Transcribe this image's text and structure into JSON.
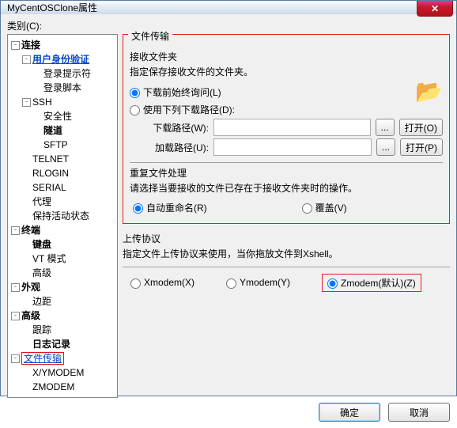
{
  "window": {
    "title": "MyCentOSClone属性",
    "close_aria": "Close"
  },
  "category_label": "类别(C):",
  "tree": {
    "conn": "连接",
    "auth": "用户身份验证",
    "loginprompt": "登录提示符",
    "loginscript": "登录脚本",
    "ssh": "SSH",
    "security": "安全性",
    "tunnel": "隧道",
    "sftp": "SFTP",
    "telnet": "TELNET",
    "rlogin": "RLOGIN",
    "serial": "SERIAL",
    "proxy": "代理",
    "keepalive": "保持活动状态",
    "terminal": "终端",
    "keyboard": "键盘",
    "vtmode": "VT 模式",
    "advanced1": "高级",
    "appearance": "外观",
    "margin": "边距",
    "advanced2": "高级",
    "trace": "跟踪",
    "logging": "日志记录",
    "filetransfer": "文件传输",
    "xymodem": "X/YMODEM",
    "zmodem": "ZMODEM"
  },
  "ft": {
    "group_label": "文件传输",
    "recv_folder_title": "接收文件夹",
    "recv_folder_desc": "指定保存接收文件的文件夹。",
    "ask_before": "下载前始终询问(L)",
    "use_path": "使用下列下载路径(D):",
    "dl_path_label": "下载路径(W):",
    "dl_path_value": "",
    "open_w": "打开(O)",
    "ul_path_label": "加载路径(U):",
    "ul_path_value": "",
    "open_p": "打开(P)",
    "dots": "...",
    "dup_title": "重复文件处理",
    "dup_desc": "请选择当要接收的文件已存在于接收文件夹时的操作。",
    "auto_rename": "自动重命名(R)",
    "overwrite": "覆盖(V)",
    "upload_proto_title": "上传协议",
    "upload_proto_desc": "指定文件上传协议来使用，当你拖放文件到Xshell。",
    "xmodem": "Xmodem(X)",
    "ymodem": "Ymodem(Y)",
    "zmodem": "Zmodem(默认)(Z)"
  },
  "buttons": {
    "ok": "确定",
    "cancel": "取消"
  }
}
